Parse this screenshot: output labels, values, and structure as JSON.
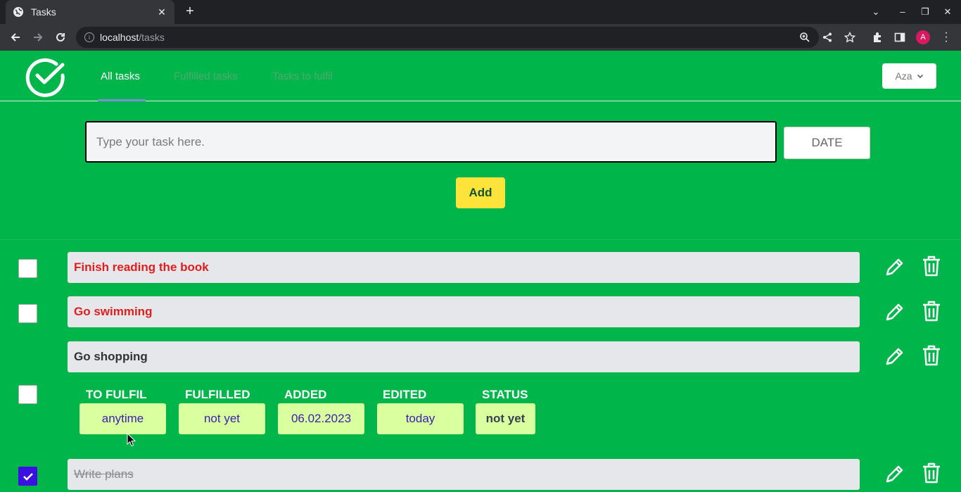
{
  "browser": {
    "tab_title": "Tasks",
    "url_host": "localhost",
    "url_path": "/tasks",
    "avatar_letter": "A"
  },
  "header": {
    "nav": [
      "All tasks",
      "Fulfilled tasks",
      "Tasks to fulfil"
    ],
    "user": "Aza"
  },
  "form": {
    "placeholder": "Type your task here.",
    "date_label": "DATE",
    "add_label": "Add"
  },
  "tasks": [
    {
      "text": "Finish reading the book",
      "checked": false
    },
    {
      "text": "Go swimming",
      "checked": false
    },
    {
      "text": "Go shopping",
      "checked": false
    },
    {
      "text": "Write plans",
      "checked": true
    }
  ],
  "details": {
    "labels": [
      "TO FULFIL",
      "FULFILLED",
      "ADDED",
      "EDITED",
      "STATUS"
    ],
    "values": [
      "anytime",
      "not yet",
      "06.02.2023",
      "today",
      "not yet"
    ]
  },
  "colors": {
    "background": "#00b64b",
    "accent_yellow": "#fde33a",
    "overdue_text": "#e11d1d",
    "checkbox_checked": "#3b10e0",
    "detail_bg": "#d9ff9f"
  }
}
